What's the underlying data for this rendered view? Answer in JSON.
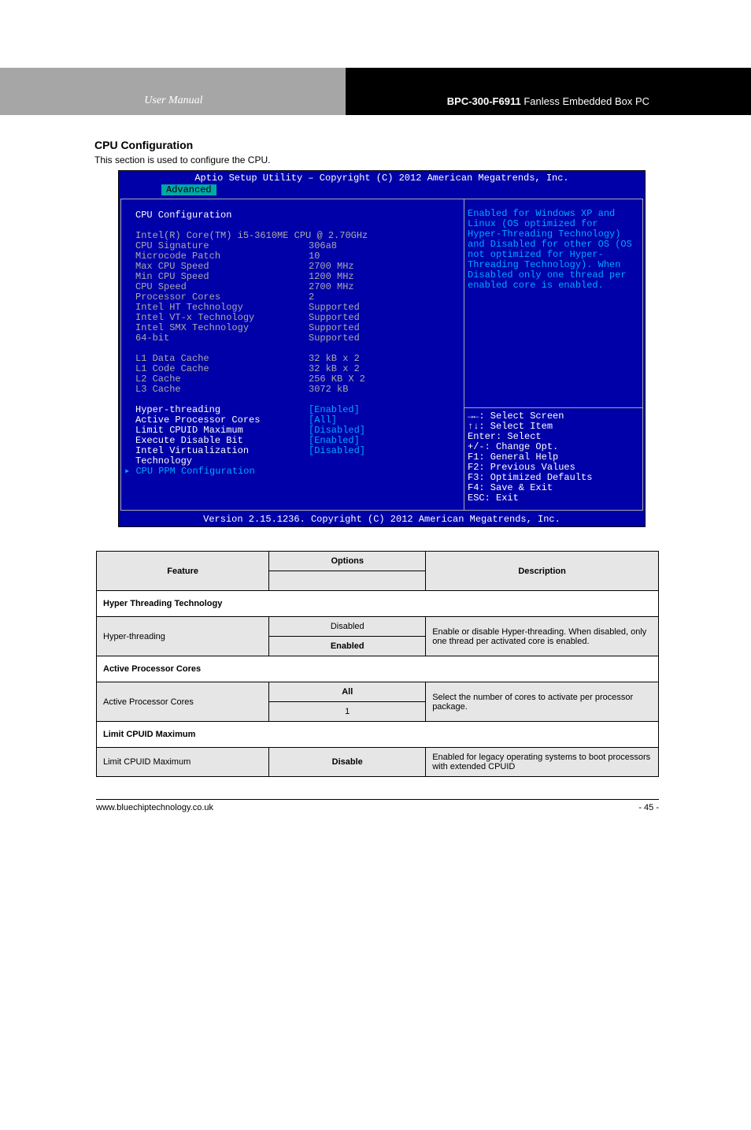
{
  "header": {
    "left": "User Manual",
    "right_bold": "BPC-300-F6911",
    "right_rest": " Fanless Embedded Box PC"
  },
  "section": {
    "title": "CPU Configuration",
    "sub": "This section is used to configure the CPU."
  },
  "bios": {
    "title": "Aptio Setup Utility – Copyright (C) 2012 American Megatrends, Inc.",
    "tab": "Advanced",
    "heading": "CPU Configuration",
    "cpu_name": "Intel(R) Core(TM) i5-3610ME CPU @ 2.70GHz",
    "rows": [
      {
        "label": "CPU Signature",
        "value": "306a8"
      },
      {
        "label": "Microcode Patch",
        "value": "10"
      },
      {
        "label": "Max CPU Speed",
        "value": "2700 MHz"
      },
      {
        "label": "Min CPU Speed",
        "value": "1200 MHz"
      },
      {
        "label": "CPU Speed",
        "value": "2700 MHz"
      },
      {
        "label": "Processor Cores",
        "value": "2"
      },
      {
        "label": "Intel HT Technology",
        "value": "Supported"
      },
      {
        "label": "Intel VT-x Technology",
        "value": "Supported"
      },
      {
        "label": "Intel SMX Technology",
        "value": "Supported"
      },
      {
        "label": "64-bit",
        "value": "Supported"
      }
    ],
    "cache": [
      {
        "label": "L1 Data Cache",
        "value": "32 kB x 2"
      },
      {
        "label": "L1 Code Cache",
        "value": "32 kB x 2"
      },
      {
        "label": "L2 Cache",
        "value": "256 KB X 2"
      },
      {
        "label": "L3 Cache",
        "value": "3072 kB"
      }
    ],
    "options": [
      {
        "label": "Hyper-threading",
        "value": "[Enabled]"
      },
      {
        "label": "Active Processor Cores",
        "value": "[All]"
      },
      {
        "label": "Limit CPUID Maximum",
        "value": "[Disabled]"
      },
      {
        "label": "Execute Disable Bit",
        "value": "[Enabled]"
      },
      {
        "label": "Intel Virtualization Technology",
        "value": "[Disabled]"
      }
    ],
    "submenu": "CPU PPM Configuration",
    "help": "Enabled for Windows XP and Linux (OS optimized for Hyper-Threading Technology) and Disabled for other OS (OS not optimized for Hyper-Threading Technology). When Disabled only one thread per enabled core is enabled.",
    "keys": [
      "→←: Select Screen",
      "↑↓: Select Item",
      "Enter: Select",
      "+/-: Change Opt.",
      "F1: General Help",
      "F2: Previous Values",
      "F3: Optimized Defaults",
      "F4: Save & Exit",
      "ESC: Exit"
    ],
    "footer": "Version 2.15.1236. Copyright (C) 2012 American Megatrends, Inc."
  },
  "table": {
    "headers": [
      "Feature",
      "Options",
      "Description"
    ],
    "groups": [
      {
        "section": "Hyper Threading Technology",
        "feature": "Hyper-threading",
        "opts": [
          "Disabled",
          "Enabled"
        ],
        "default": 1,
        "desc": "Enable or disable Hyper-threading. When disabled, only one thread per activated core is enabled."
      },
      {
        "section": "Active Processor Cores",
        "feature": "Active Processor Cores",
        "opts": [
          "All",
          "1"
        ],
        "default": 0,
        "desc": "Select the number of cores to activate per processor package."
      },
      {
        "section": "Limit CPUID Maximum",
        "feature": "Limit CPUID Maximum",
        "opts": [
          "Disable"
        ],
        "default": 0,
        "desc": "Enabled for legacy operating systems to boot processors with extended CPUID"
      }
    ]
  },
  "footer": {
    "left": "www.bluechiptechnology.co.uk",
    "right": "- 45 -"
  }
}
